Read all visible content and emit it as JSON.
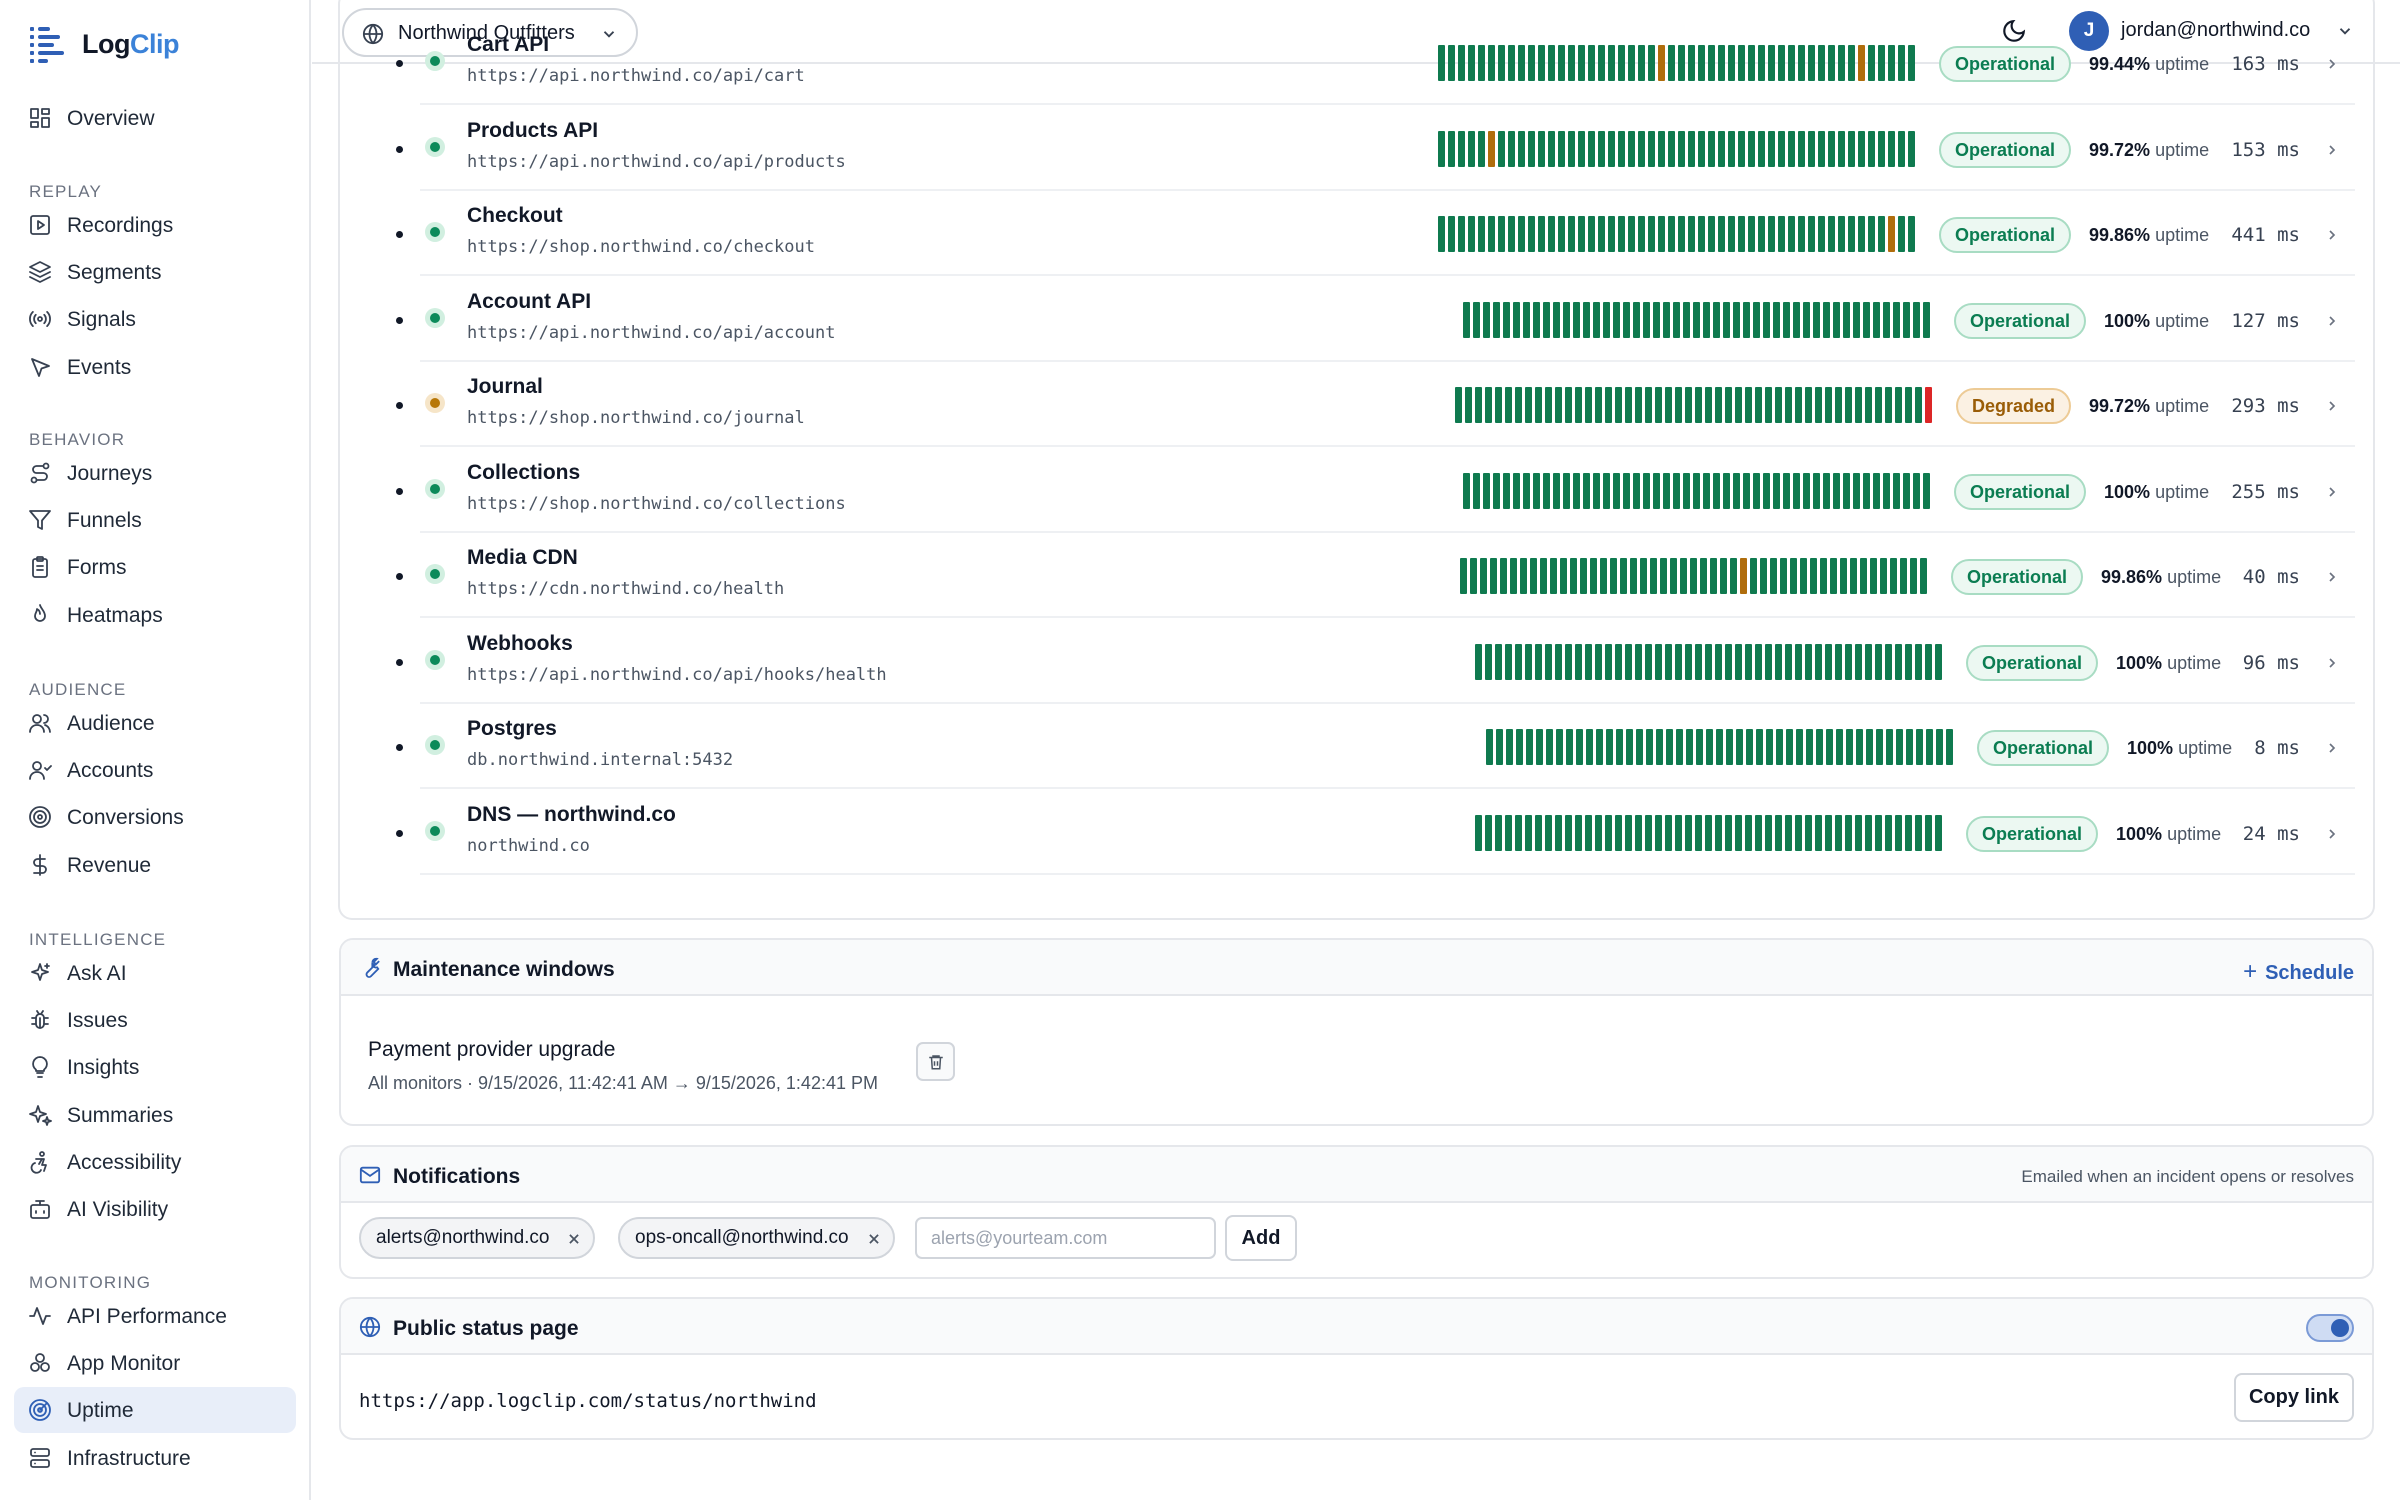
{
  "app": {
    "logo_a": "Log",
    "logo_b": "Clip"
  },
  "topbar": {
    "org": "Northwind Outfitters",
    "avatar_initial": "J",
    "user": "jordan@northwind.co"
  },
  "sidebar": {
    "overview": "Overview",
    "sections": [
      {
        "title": "REPLAY",
        "items": [
          "Recordings",
          "Segments",
          "Signals",
          "Events"
        ]
      },
      {
        "title": "BEHAVIOR",
        "items": [
          "Journeys",
          "Funnels",
          "Forms",
          "Heatmaps"
        ]
      },
      {
        "title": "AUDIENCE",
        "items": [
          "Audience",
          "Accounts",
          "Conversions",
          "Revenue"
        ]
      },
      {
        "title": "INTELLIGENCE",
        "items": [
          "Ask AI",
          "Issues",
          "Insights",
          "Summaries",
          "Accessibility",
          "AI Visibility"
        ]
      },
      {
        "title": "MONITORING",
        "items": [
          "API Performance",
          "App Monitor",
          "Uptime",
          "Infrastructure"
        ]
      }
    ],
    "active": "Uptime"
  },
  "monitors": [
    {
      "name": "Cart API",
      "url": "https://api.northwind.co/api/cart",
      "status": "Operational",
      "uptime": "99.44%",
      "uptime_label": "uptime",
      "latency": "163 ms",
      "history": "ggggggggggggggggggggggogggggggggggggggggggoggggg"
    },
    {
      "name": "Products API",
      "url": "https://api.northwind.co/api/products",
      "status": "Operational",
      "uptime": "99.72%",
      "uptime_label": "uptime",
      "latency": "153 ms",
      "history": "gggggogggggggggggggggggggggggggggggggggggggggggg"
    },
    {
      "name": "Checkout",
      "url": "https://shop.northwind.co/checkout",
      "status": "Operational",
      "uptime": "99.86%",
      "uptime_label": "uptime",
      "latency": "441 ms",
      "history": "gggggggggggggggggggggggggggggggggggggggggggggogg"
    },
    {
      "name": "Account API",
      "url": "https://api.northwind.co/api/account",
      "status": "Operational",
      "uptime": "100%",
      "uptime_label": "uptime",
      "latency": "127 ms",
      "history": "ggggggggggggggggggggggggggggggggggggggggggggggg"
    },
    {
      "name": "Journal",
      "url": "https://shop.northwind.co/journal",
      "status": "Degraded",
      "uptime": "99.72%",
      "uptime_label": "uptime",
      "latency": "293 ms",
      "history": "gggggggggggggggggggggggggggggggggggggggggggggggr"
    },
    {
      "name": "Collections",
      "url": "https://shop.northwind.co/collections",
      "status": "Operational",
      "uptime": "100%",
      "uptime_label": "uptime",
      "latency": "255 ms",
      "history": "ggggggggggggggggggggggggggggggggggggggggggggggg"
    },
    {
      "name": "Media CDN",
      "url": "https://cdn.northwind.co/health",
      "status": "Operational",
      "uptime": "99.86%",
      "uptime_label": "uptime",
      "latency": "40 ms",
      "history": "ggggggggggggggggggggggggggggogggggggggggggggggg"
    },
    {
      "name": "Webhooks",
      "url": "https://api.northwind.co/api/hooks/health",
      "status": "Operational",
      "uptime": "100%",
      "uptime_label": "uptime",
      "latency": "96 ms",
      "history": "ggggggggggggggggggggggggggggggggggggggggggggggg"
    },
    {
      "name": "Postgres",
      "url": "db.northwind.internal:5432",
      "status": "Operational",
      "uptime": "100%",
      "uptime_label": "uptime",
      "latency": "8 ms",
      "history": "ggggggggggggggggggggggggggggggggggggggggggggggg"
    },
    {
      "name": "DNS — northwind.co",
      "url": "northwind.co",
      "status": "Operational",
      "uptime": "100%",
      "uptime_label": "uptime",
      "latency": "24 ms",
      "history": "ggggggggggggggggggggggggggggggggggggggggggggggg"
    }
  ],
  "maintenance": {
    "title": "Maintenance windows",
    "schedule": "Schedule",
    "item_title": "Payment provider upgrade",
    "item_meta": "All monitors · 9/15/2026, 11:42:41 AM → 9/15/2026, 1:42:41 PM"
  },
  "notifications": {
    "title": "Notifications",
    "subtitle": "Emailed when an incident opens or resolves",
    "emails": [
      "alerts@northwind.co",
      "ops-oncall@northwind.co"
    ],
    "input_placeholder": "alerts@yourteam.com",
    "input_value": "",
    "add": "Add"
  },
  "status_page": {
    "title": "Public status page",
    "enabled": true,
    "url": "https://app.logclip.com/status/northwind",
    "copy": "Copy link"
  },
  "colors": {
    "operational": "#0f7a4f",
    "degraded": "#b06d0c",
    "down": "#dc2626",
    "accent": "#2f5fb5"
  }
}
